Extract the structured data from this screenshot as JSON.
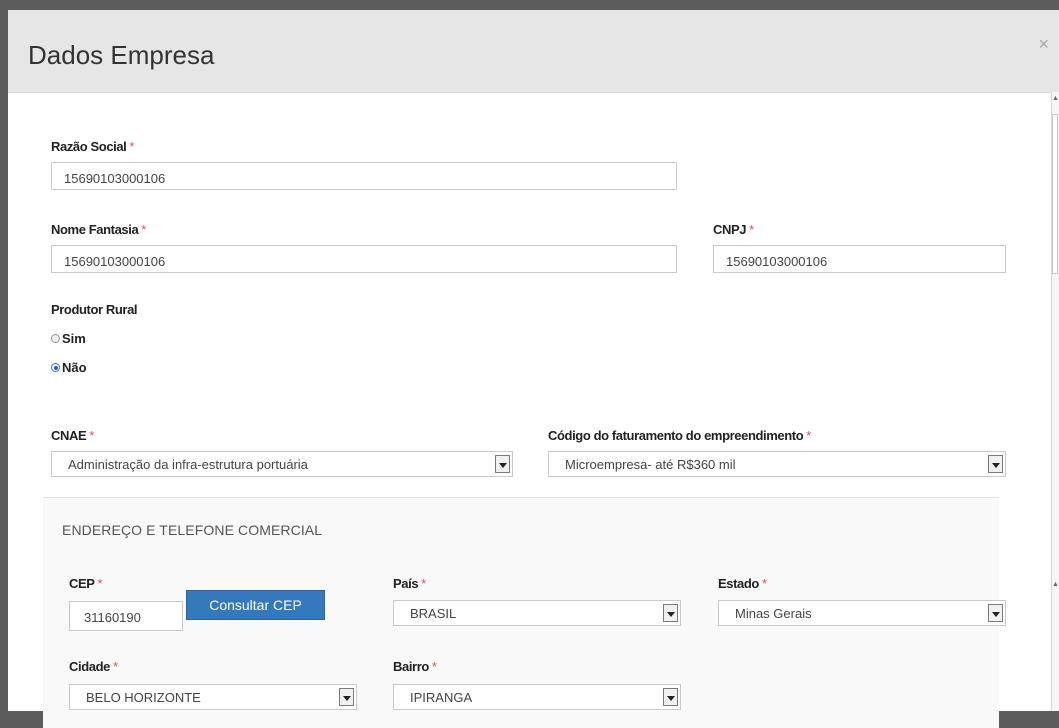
{
  "modal": {
    "title": "Dados Empresa",
    "close_symbol": "×"
  },
  "form": {
    "razao_social": {
      "label": "Razão Social",
      "required": "*",
      "value": "15690103000106"
    },
    "nome_fantasia": {
      "label": "Nome Fantasia",
      "required": "*",
      "value": "15690103000106"
    },
    "cnpj": {
      "label": "CNPJ",
      "required": "*",
      "value": "15690103000106"
    },
    "produtor_rural": {
      "label": "Produtor Rural",
      "options": [
        {
          "label": "Sim",
          "checked": false
        },
        {
          "label": "Não",
          "checked": true
        }
      ]
    },
    "cnae": {
      "label": "CNAE",
      "required": "*",
      "value": "Administração da infra-estrutura portuária"
    },
    "faturamento": {
      "label": "Código do faturamento do empreendimento",
      "required": "*",
      "value": "Microempresa- até R$360 mil"
    }
  },
  "address": {
    "section_title": "ENDEREÇO E TELEFONE COMERCIAL",
    "cep": {
      "label": "CEP",
      "required": "*",
      "value": "31160190"
    },
    "consultar_button": "Consultar CEP",
    "pais": {
      "label": "País",
      "required": "*",
      "value": "BRASIL"
    },
    "estado": {
      "label": "Estado",
      "required": "*",
      "value": "Minas Gerais"
    },
    "cidade": {
      "label": "Cidade",
      "required": "*",
      "value": "BELO HORIZONTE"
    },
    "bairro": {
      "label": "Bairro",
      "required": "*",
      "value": "IPIRANGA"
    }
  },
  "icons": {
    "close": "close-icon",
    "select_arrow": "chevron-down-icon",
    "scroll_up": "triangle-up-icon",
    "scroll_down": "triangle-down-icon"
  },
  "colors": {
    "required": "#d9534f",
    "button": "#3279bd",
    "header": "#e6e6e6",
    "section_bg": "#f9f9f9"
  }
}
